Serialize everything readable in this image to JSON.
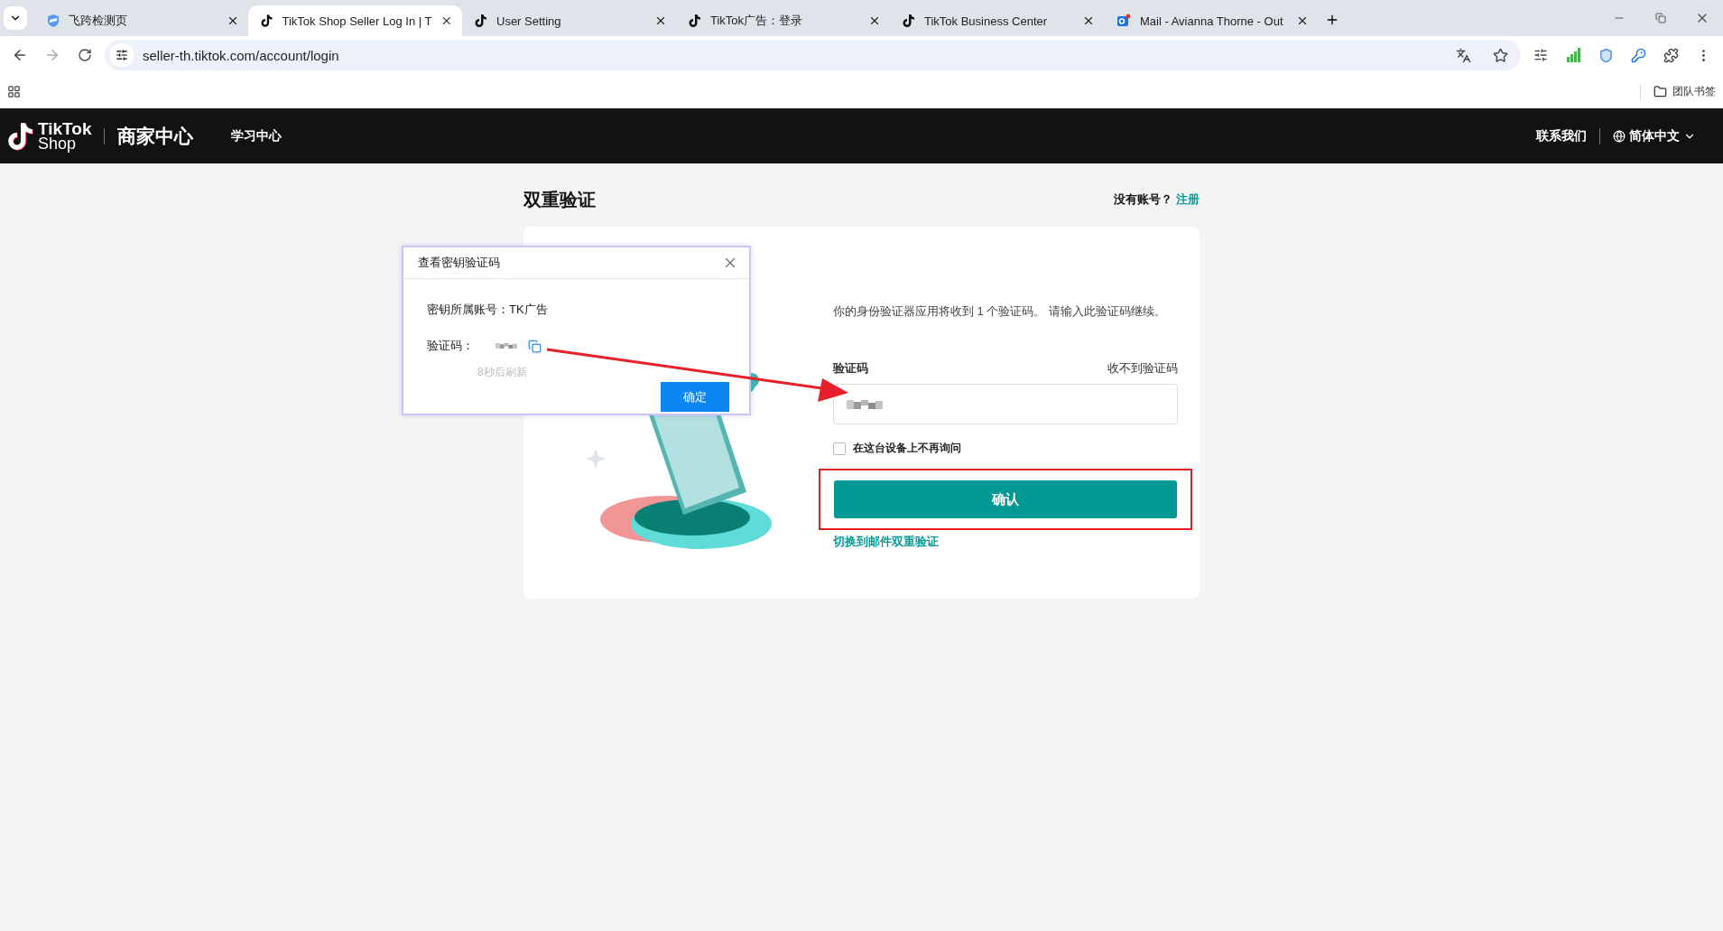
{
  "browser": {
    "tabs": [
      {
        "title": "飞跨检测页",
        "kind": "shield",
        "selected": false
      },
      {
        "title": "TikTok Shop Seller Log In | T",
        "kind": "note",
        "selected": true
      },
      {
        "title": "User Setting",
        "kind": "note",
        "selected": false
      },
      {
        "title": "TikTok广告：登录",
        "kind": "note",
        "selected": false
      },
      {
        "title": "TikTok Business Center",
        "kind": "note",
        "selected": false
      },
      {
        "title": "Mail - Avianna Thorne - Out",
        "kind": "mail",
        "selected": false
      }
    ],
    "address": "seller-th.tiktok.com/account/login",
    "bookmark_folder": "团队书签"
  },
  "header": {
    "logo_top": "TikTok",
    "logo_bottom": "Shop",
    "product": "商家中心",
    "nav": [
      "学习中心"
    ],
    "contact": "联系我们",
    "language": "简体中文"
  },
  "page": {
    "title": "双重验证",
    "no_account": "没有账号？",
    "register": "注册",
    "description": "你的身份验证器应用将收到 1 个验证码。 请输入此验证码继续。",
    "code_label": "验证码",
    "no_code": "收不到验证码",
    "remember": {
      "label": "在这台设备上不再询问",
      "checked": false
    },
    "confirm": "确认",
    "switch_link": "切换到邮件双重验证"
  },
  "popup": {
    "title": "查看密钥验证码",
    "account_label": "密钥所属账号：",
    "account": "TK广告",
    "code_label": "验证码：",
    "refresh": "8秒后刷新",
    "ok": "确定"
  }
}
